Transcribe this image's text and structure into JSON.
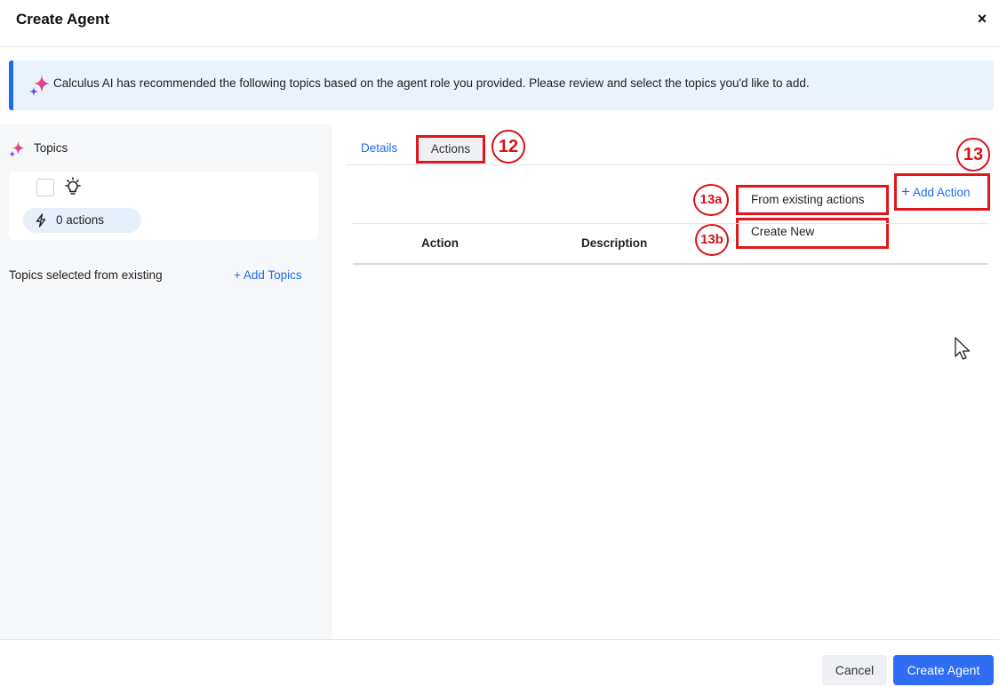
{
  "header": {
    "title": "Create Agent",
    "close_glyph": "×",
    "close_icon": "close-icon"
  },
  "banner": {
    "icon": "sparkle-icon",
    "message": "Calculus AI has recommended the following topics based on the agent role you provided. Please review and select the topics you'd like to add."
  },
  "left_panel": {
    "topics_label": "Topics",
    "topics_icon": "sparkle-icon",
    "topic_card": {
      "checked": false,
      "topic_icon": "lightbulb-icon",
      "actions_icon": "bolt-icon",
      "actions_count": "0 actions"
    },
    "selected_label": "Topics selected from existing",
    "add_topics_label": "+ Add Topics"
  },
  "tabs": {
    "details": "Details",
    "actions": "Actions",
    "active": "Actions"
  },
  "annotations": {
    "m12": "12",
    "m13": "13",
    "m13a": "13a",
    "m13b": "13b",
    "color": "#d6141a"
  },
  "add_action": {
    "plus": "+",
    "label": "Add Action"
  },
  "add_action_menu": {
    "from_existing": "From existing actions",
    "create_new": "Create New"
  },
  "table": {
    "columns": [
      "Action",
      "Description"
    ]
  },
  "footer": {
    "cancel": "Cancel",
    "create": "Create Agent"
  },
  "colors": {
    "accent": "#1f6bf0",
    "primary_button": "#2f6df3",
    "highlight_box": "#e0161b",
    "banner_bg": "#eaf2fd"
  }
}
